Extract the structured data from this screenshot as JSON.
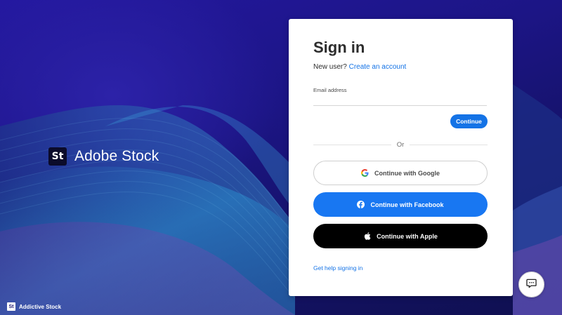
{
  "brand": {
    "logo_text": "St",
    "name": "Adobe Stock"
  },
  "credit": {
    "logo_text": "St",
    "text": "Addictive Stock"
  },
  "signin": {
    "title": "Sign in",
    "new_user_prompt": "New user?",
    "create_account_link": "Create an account",
    "email_label": "Email address",
    "email_value": "",
    "continue_button": "Continue",
    "divider_text": "Or",
    "google_button": "Continue with Google",
    "facebook_button": "Continue with Facebook",
    "apple_button": "Continue with Apple",
    "help_link": "Get help signing in"
  },
  "chat": {
    "icon": "chat-bubble-icon"
  },
  "colors": {
    "accent": "#1473e6",
    "facebook": "#1877f2",
    "apple": "#000000",
    "background": "#1a1470"
  }
}
